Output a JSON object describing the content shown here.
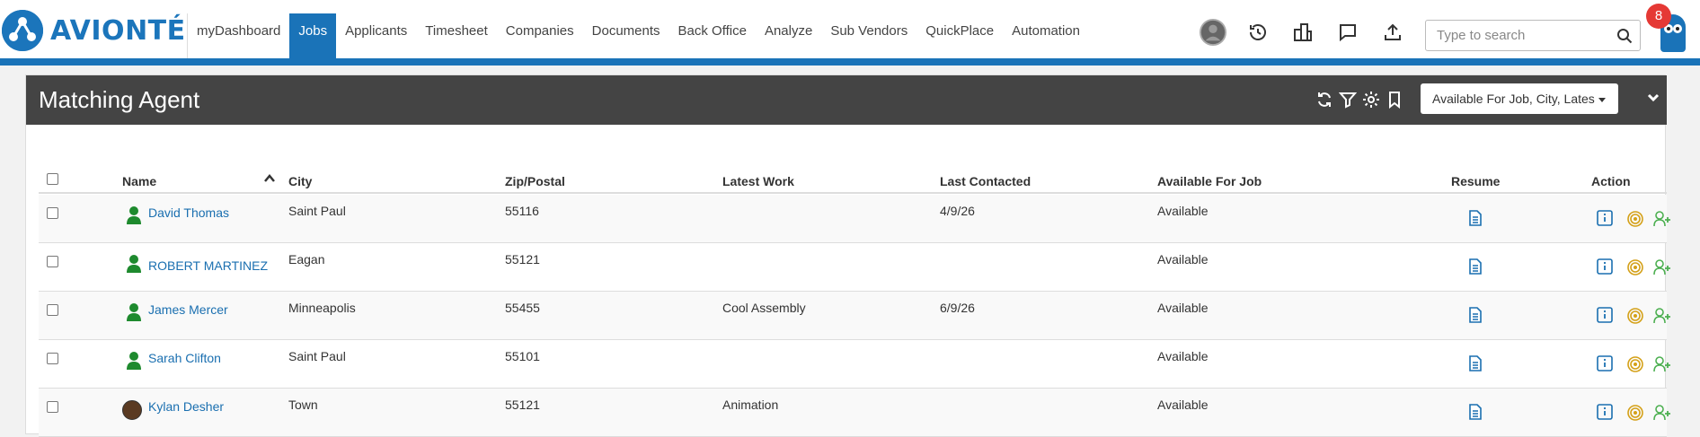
{
  "brand": {
    "name": "AVIONTÉ",
    "color": "#1b75bb"
  },
  "nav": {
    "items": [
      {
        "label": "myDashboard"
      },
      {
        "label": "Jobs",
        "active": true
      },
      {
        "label": "Applicants"
      },
      {
        "label": "Timesheet"
      },
      {
        "label": "Companies"
      },
      {
        "label": "Documents"
      },
      {
        "label": "Back Office"
      },
      {
        "label": "Analyze"
      },
      {
        "label": "Sub Vendors"
      },
      {
        "label": "QuickPlace"
      },
      {
        "label": "Automation"
      }
    ]
  },
  "topbar": {
    "search_placeholder": "Type to search",
    "notification_count": "8",
    "icons": [
      "user-avatar",
      "history-icon",
      "buildings-icon",
      "chat-icon",
      "upload-icon",
      "search-icon",
      "owl-assistant-icon"
    ]
  },
  "panel": {
    "title": "Matching Agent",
    "view_select": "Available For Job, City, Lates",
    "header_icons": [
      "refresh-icon",
      "filter-icon",
      "gear-icon",
      "bookmark-icon",
      "chevron-down-icon"
    ]
  },
  "table": {
    "columns": {
      "name": "Name",
      "city": "City",
      "zip": "Zip/Postal",
      "latest_work": "Latest Work",
      "last_contacted": "Last Contacted",
      "available": "Available For Job",
      "resume": "Resume",
      "action": "Action"
    },
    "sort": "name-ascending",
    "rows": [
      {
        "name": "David Thomas",
        "city": "Saint Paul",
        "zip": "55116",
        "latest_work": "",
        "last_contacted": "4/9/26",
        "available": "Available",
        "avatar": "person-icon"
      },
      {
        "name": "ROBERT MARTINEZ",
        "city": "Eagan",
        "zip": "55121",
        "latest_work": "",
        "last_contacted": "",
        "available": "Available",
        "avatar": "person-icon"
      },
      {
        "name": "James Mercer",
        "city": "Minneapolis",
        "zip": "55455",
        "latest_work": "Cool Assembly",
        "last_contacted": "6/9/26",
        "available": "Available",
        "avatar": "person-icon"
      },
      {
        "name": "Sarah Clifton",
        "city": "Saint Paul",
        "zip": "55101",
        "latest_work": "",
        "last_contacted": "",
        "available": "Available",
        "avatar": "person-icon"
      },
      {
        "name": "Kylan Desher",
        "city": "Town",
        "zip": "55121",
        "latest_work": "Animation",
        "last_contacted": "",
        "available": "Available",
        "avatar": "photo"
      }
    ]
  },
  "colors": {
    "accent": "#1a73b8",
    "header_bg": "#444444",
    "person_green": "#1e8a2e",
    "action_gold": "#d4a017",
    "action_green": "#4caf50"
  }
}
